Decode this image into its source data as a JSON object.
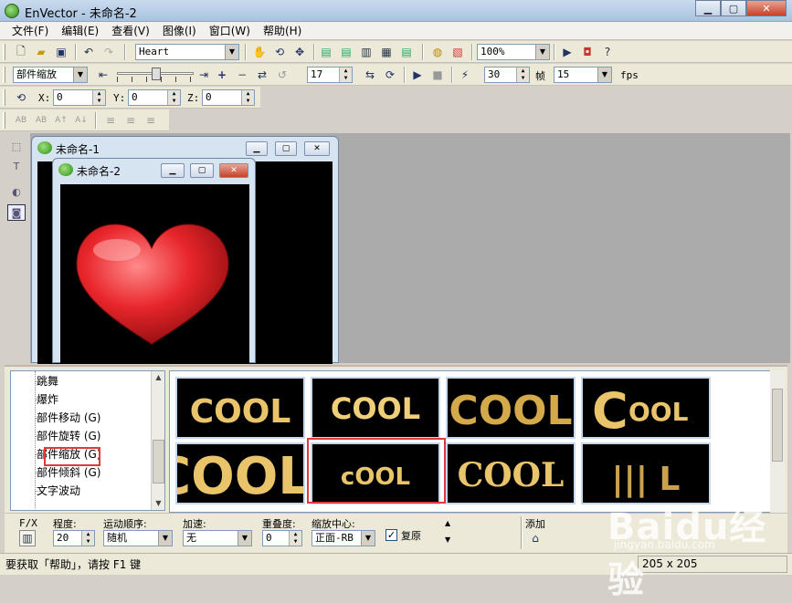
{
  "window": {
    "app_name": "EnVector",
    "doc_name": "未命名-2",
    "title": "EnVector - 未命名-2"
  },
  "menu": [
    "文件(F)",
    "编辑(E)",
    "查看(V)",
    "图像(I)",
    "窗口(W)",
    "帮助(H)"
  ],
  "toolbar1": {
    "shape_combo": "Heart",
    "zoom_combo": "100%"
  },
  "toolbar2": {
    "effect_combo": "部件缩放",
    "spin1": "17",
    "spin2": "30",
    "frame_label": "帧",
    "fps_value": "15",
    "fps_label": "fps"
  },
  "toolbar3": {
    "x_label": "X:",
    "x_value": "0",
    "y_label": "Y:",
    "y_value": "0",
    "z_label": "Z:",
    "z_value": "0"
  },
  "toolbar4": {
    "icons": [
      "AB",
      "AB",
      "A↑",
      "A↓"
    ]
  },
  "child1": {
    "title": "未命名-1"
  },
  "child2": {
    "title": "未命名-2"
  },
  "tree": {
    "items": [
      "跳舞",
      "爆炸",
      "部件移动 (G)",
      "部件旋转 (G)",
      "部件缩放 (G)",
      "部件倾斜 (G)",
      "文字波动"
    ],
    "selected": "部件缩放"
  },
  "gallery": {
    "tiles": [
      {
        "text": "COOL",
        "style": "plain"
      },
      {
        "text": "COOL",
        "style": "bold"
      },
      {
        "text": "COOL",
        "style": "overlap"
      },
      {
        "text": "COOL",
        "style": "big-c"
      },
      {
        "text": "COOL",
        "style": "zoom"
      },
      {
        "text": "cOOL",
        "style": "small-c"
      },
      {
        "text": "COOL",
        "style": "serif"
      },
      {
        "text": "||| L",
        "style": "bars"
      }
    ]
  },
  "options": {
    "fx_label": "F/X",
    "degree_label": "程度:",
    "degree_value": "20",
    "order_label": "运动顺序:",
    "order_value": "随机",
    "accel_label": "加速:",
    "accel_value": "无",
    "overlap_label": "重叠度:",
    "overlap_value": "0",
    "center_label": "缩放中心:",
    "center_value": "正面-RB",
    "restore_label": "复原",
    "add_label": "添加"
  },
  "status": {
    "hint": "要获取「帮助」，请按 F1 键",
    "size": "205 x 205"
  },
  "watermark": {
    "text": "Baidu经验",
    "sub": "jingyan.baidu.com"
  },
  "colors": {
    "title_bar": "#b9cfe8",
    "highlight": "#e03a3a",
    "heart": "#e8262b",
    "text_gold": "#e9c46a"
  }
}
